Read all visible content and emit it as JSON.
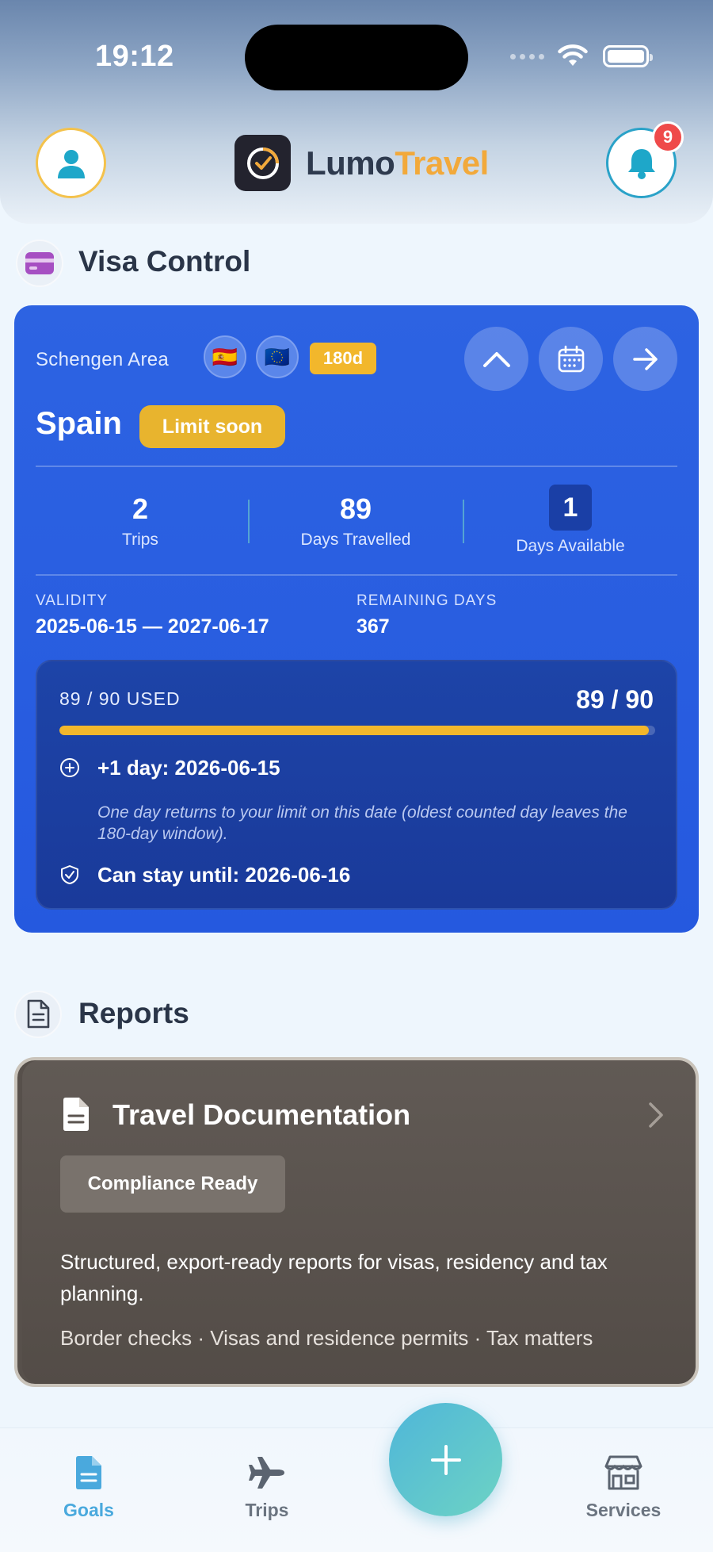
{
  "status_bar": {
    "time": "19:12"
  },
  "header": {
    "logo_part1": "Lumo",
    "logo_part2": "Travel",
    "notification_count": "9"
  },
  "visa_section": {
    "title": "Visa Control",
    "card": {
      "region": "Schengen Area",
      "flags": [
        "🇪🇸",
        "🇪🇺"
      ],
      "window_badge": "180d",
      "country": "Spain",
      "status": "Limit soon",
      "stats": [
        {
          "value": "2",
          "label": "Trips"
        },
        {
          "value": "89",
          "label": "Days Travelled"
        },
        {
          "value": "1",
          "label": "Days Available"
        }
      ],
      "validity_label": "VALIDITY",
      "validity_value": "2025-06-15 — 2027-06-17",
      "remaining_label": "REMAINING DAYS",
      "remaining_value": "367",
      "usage": {
        "used_label": "89 / 90 USED",
        "used_value": "89 / 90",
        "used_fraction": 0.989,
        "plus_day": "+1 day: 2026-06-15",
        "note": "One day returns to your limit on this date (oldest counted day leaves the 180-day window).",
        "stay_until": "Can stay until: 2026-06-16"
      }
    }
  },
  "reports_section": {
    "title": "Reports",
    "card": {
      "title": "Travel Documentation",
      "badge": "Compliance Ready",
      "description": "Structured, export-ready reports for visas, residency and tax planning.",
      "tags": "Border checks · Visas and residence permits · Tax matters"
    }
  },
  "bottom_nav": {
    "items": [
      {
        "label": "Goals",
        "icon": "document-icon",
        "active": true
      },
      {
        "label": "Trips",
        "icon": "airplane-icon",
        "active": false
      },
      {
        "label": "Services",
        "icon": "store-icon",
        "active": false
      }
    ],
    "fab_icon": "plus-icon"
  },
  "colors": {
    "accent_blue": "#2d63e2",
    "warning_yellow": "#f2b72c",
    "logo_orange": "#f2a93b",
    "active_nav": "#4aa9dd",
    "badge_red": "#ef4a4a"
  }
}
